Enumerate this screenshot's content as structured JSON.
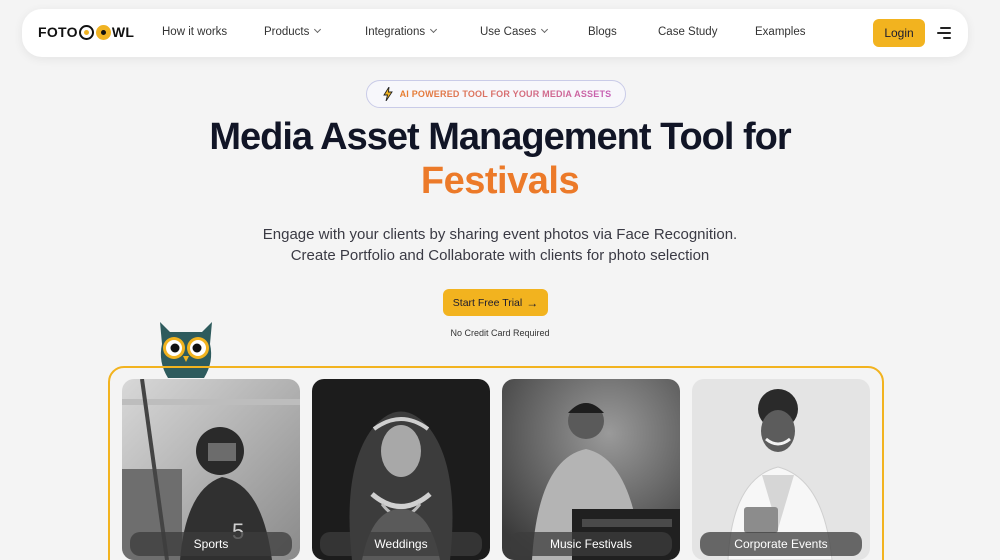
{
  "nav": {
    "logo": {
      "part1": "FOTO",
      "part2": "WL"
    },
    "items": [
      {
        "label": "How it works",
        "has_dropdown": false
      },
      {
        "label": "Products",
        "has_dropdown": true
      },
      {
        "label": "Integrations",
        "has_dropdown": true
      },
      {
        "label": "Use Cases",
        "has_dropdown": true
      },
      {
        "label": "Blogs",
        "has_dropdown": false
      },
      {
        "label": "Case Study",
        "has_dropdown": false
      },
      {
        "label": "Examples",
        "has_dropdown": false
      }
    ],
    "login_label": "Login",
    "menu_icon": "hamburger-menu-icon"
  },
  "badge": {
    "text": "AI POWERED TOOL FOR YOUR MEDIA ASSETS",
    "icon": "sparkle-bolt-icon"
  },
  "hero": {
    "title_line1": "Media Asset Management Tool for",
    "title_line2": "Festivals",
    "subtitle_line1": "Engage with your clients by sharing event photos via Face Recognition.",
    "subtitle_line2": "Create Portfolio and Collaborate with clients for photo selection",
    "cta_label": "Start Free Trial",
    "cta_icon": "arrow-right-icon",
    "note": "No Credit Card Required"
  },
  "cards": [
    {
      "label": "Sports"
    },
    {
      "label": "Weddings"
    },
    {
      "label": "Music Festivals"
    },
    {
      "label": "Corporate Events"
    }
  ],
  "colors": {
    "accent": "#f2b31f",
    "highlight": "#ec7a29",
    "title": "#111526",
    "background": "#f4f4f4"
  }
}
